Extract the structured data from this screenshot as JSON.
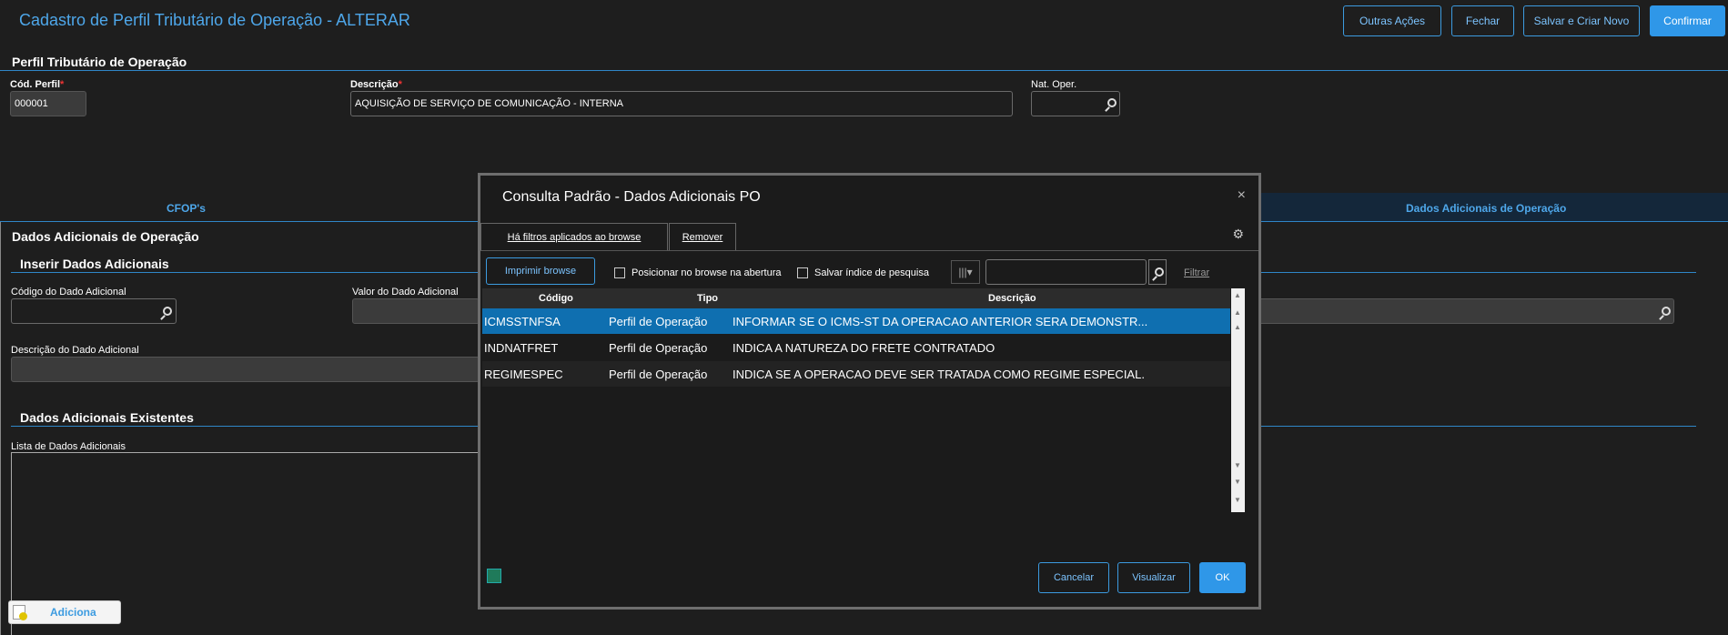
{
  "header": {
    "title": "Cadastro de Perfil Tributário de Operação - ALTERAR",
    "buttons": {
      "outras_acoes": "Outras Ações",
      "fechar": "Fechar",
      "salvar_criar": "Salvar e Criar Novo",
      "confirmar": "Confirmar"
    }
  },
  "perfil": {
    "section_title": "Perfil Tributário de Operação",
    "cod_label": "Cód. Perfil",
    "cod_value": "000001",
    "desc_label": "Descrição",
    "desc_value": "AQUISIÇÃO DE SERVIÇO DE COMUNICAÇÃO - INTERNA",
    "natoper_label": "Nat. Oper.",
    "required_mark": "*"
  },
  "tabs": {
    "cfops": "CFOP's",
    "dados_adicionais": "Dados Adicionais de Operação"
  },
  "dados": {
    "section_title": "Dados Adicionais de Operação",
    "inserir_title": "Inserir Dados Adicionais",
    "codigo_label": "Código do Dado Adicional",
    "valor_label": "Valor do Dado Adicional",
    "descricao_label": "Descrição do Dado Adicional",
    "existentes_title": "Dados Adicionais Existentes",
    "lista_label": "Lista de Dados Adicionais",
    "adiciona_label": "Adiciona"
  },
  "modal": {
    "title": "Consulta Padrão - Dados Adicionais PO",
    "close": "×",
    "filter_tab": "Há filtros aplicados ao browse",
    "remover": "Remover",
    "imprimir": "Imprimir browse",
    "posicionar": "Posicionar no browse na abertura",
    "salvar_indice": "Salvar índice de pesquisa",
    "filtrar": "Filtrar",
    "columns": {
      "codigo": "Código",
      "tipo": "Tipo",
      "descricao": "Descrição"
    },
    "rows": [
      {
        "codigo": "ICMSSTNFSA",
        "tipo": "Perfil de Operação",
        "descricao": "INFORMAR SE O ICMS-ST DA OPERACAO ANTERIOR SERA DEMONSTR..."
      },
      {
        "codigo": "INDNATFRET",
        "tipo": "Perfil de Operação",
        "descricao": "INDICA A NATUREZA DO FRETE CONTRATADO"
      },
      {
        "codigo": "REGIMESPEC",
        "tipo": "Perfil de Operação",
        "descricao": "INDICA SE A OPERACAO DEVE SER TRATADA COMO REGIME ESPECIAL."
      }
    ],
    "buttons": {
      "cancelar": "Cancelar",
      "visualizar": "Visualizar",
      "ok": "OK"
    }
  }
}
